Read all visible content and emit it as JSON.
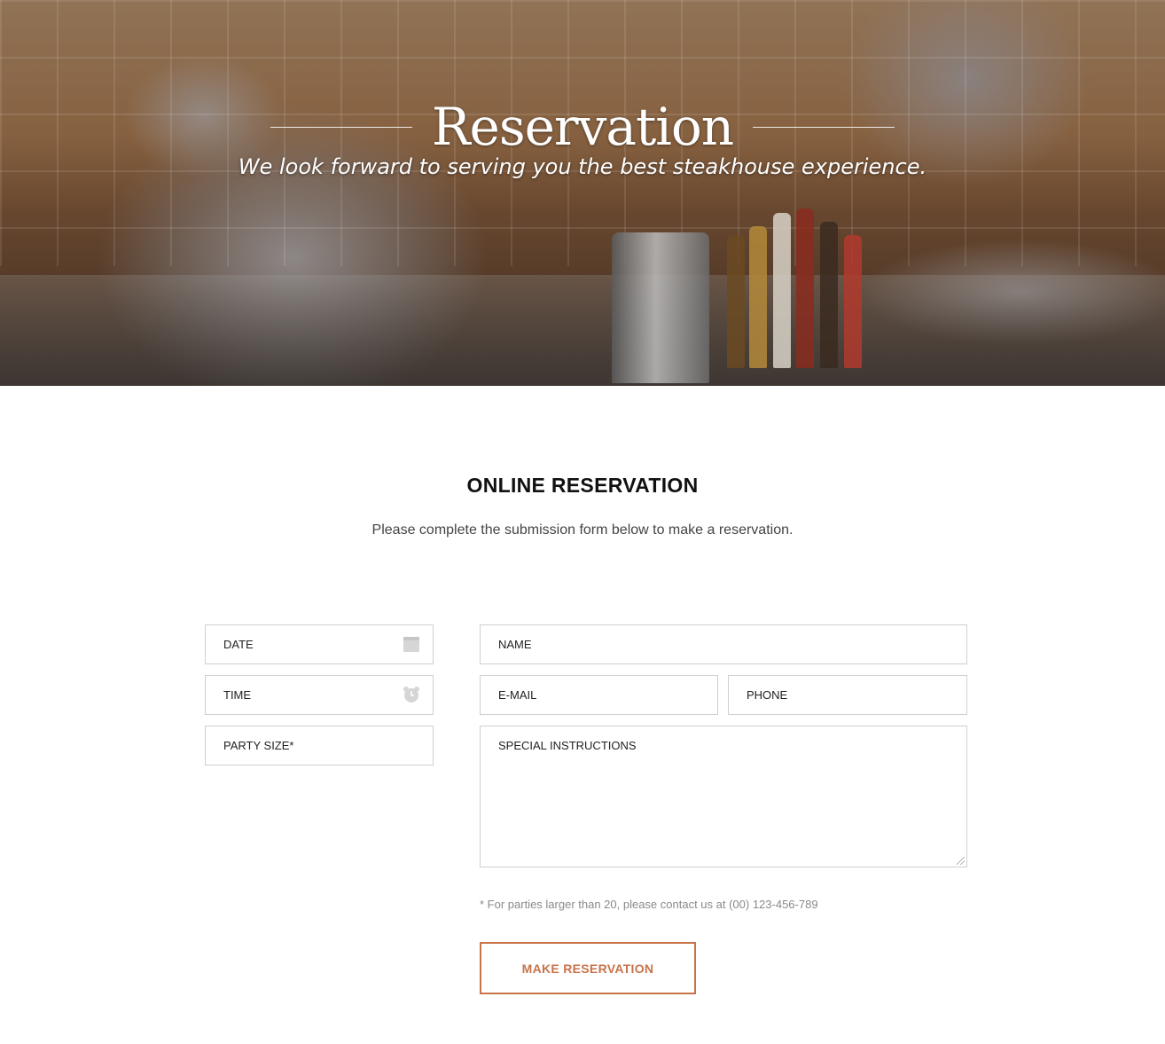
{
  "hero": {
    "title": "Reservation",
    "subtitle": "We look forward to serving you the best steakhouse experience."
  },
  "section": {
    "title": "ONLINE RESERVATION",
    "description": "Please complete the submission form below to make a reservation."
  },
  "form": {
    "date_placeholder": "DATE",
    "time_placeholder": "TIME",
    "party_size_placeholder": "PARTY SIZE*",
    "name_placeholder": "NAME",
    "email_placeholder": "E-MAIL",
    "phone_placeholder": "PHONE",
    "instructions_placeholder": "SPECIAL INSTRUCTIONS",
    "note": "* For parties larger than 20, please contact us at (00) 123-456-789",
    "submit_label": "MAKE RESERVATION",
    "icons": {
      "date": "calendar-icon",
      "time": "alarm-clock-icon"
    }
  },
  "colors": {
    "accent": "#c8734a",
    "field_border": "#cfcfcf",
    "note_text": "#8a8a8a"
  }
}
